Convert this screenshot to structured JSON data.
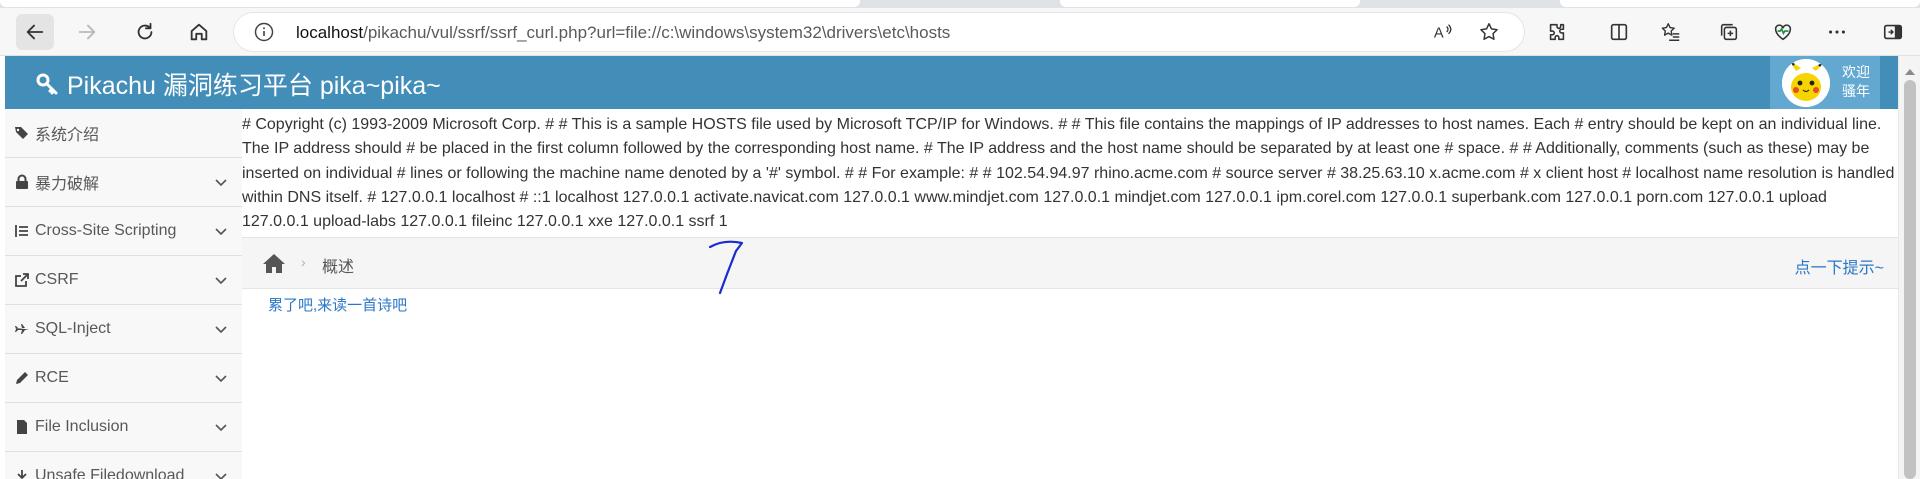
{
  "browser": {
    "url_host": "localhost",
    "url_path": "/pikachu/vul/ssrf/ssrf_curl.php?url=file://c:\\windows\\system32\\drivers\\etc\\hosts",
    "back_icon": "arrow-left-icon",
    "forward_icon": "arrow-right-icon",
    "refresh_icon": "refresh-icon",
    "home_icon": "home-icon",
    "read_aloud_icon": "read-aloud-icon",
    "favorite_icon": "star-icon",
    "extensions_icon": "puzzle-icon",
    "split_screen_icon": "split-screen-icon",
    "favorites_icon": "favorites-list-icon",
    "collections_icon": "collections-icon",
    "performance_icon": "heart-pulse-icon",
    "more_icon": "more-dots-icon",
    "sidebar_icon": "sidebar-toggle-icon"
  },
  "header": {
    "brand_icon": "key-icon",
    "title": "Pikachu 漏洞练习平台 pika~pika~",
    "welcome_line1": "欢迎",
    "welcome_line2": "骚年"
  },
  "sidebar": {
    "items": [
      {
        "label": "系统介绍",
        "icon": "tags-icon",
        "expandable": false
      },
      {
        "label": "暴力破解",
        "icon": "lock-icon",
        "expandable": true
      },
      {
        "label": "Cross-Site Scripting",
        "icon": "indent-icon",
        "expandable": true
      },
      {
        "label": "CSRF",
        "icon": "share-square-icon",
        "expandable": true
      },
      {
        "label": "SQL-Inject",
        "icon": "fighter-jet-icon",
        "expandable": true
      },
      {
        "label": "RCE",
        "icon": "pencil-icon",
        "expandable": true
      },
      {
        "label": "File Inclusion",
        "icon": "file-icon",
        "expandable": true
      },
      {
        "label": "Unsafe Filedownload",
        "icon": "download-icon",
        "expandable": true
      }
    ]
  },
  "main": {
    "hosts_output": "# Copyright (c) 1993-2009 Microsoft Corp. # # This is a sample HOSTS file used by Microsoft TCP/IP for Windows. # # This file contains the mappings of IP addresses to host names. Each # entry should be kept on an individual line. The IP address should # be placed in the first column followed by the corresponding host name. # The IP address and the host name should be separated by at least one # space. # # Additionally, comments (such as these) may be inserted on individual # lines or following the machine name denoted by a '#' symbol. # # For example: # # 102.54.94.97 rhino.acme.com # source server # 38.25.63.10 x.acme.com # x client host # localhost name resolution is handled within DNS itself. # 127.0.0.1 localhost # ::1 localhost 127.0.0.1 activate.navicat.com 127.0.0.1 www.mindjet.com 127.0.0.1 mindjet.com 127.0.0.1 ipm.corel.com 127.0.0.1 superbank.com 127.0.0.1 porn.com 127.0.0.1 upload 127.0.0.1 upload-labs 127.0.0.1 fileinc 127.0.0.1 xxe 127.0.0.1 ssrf 1",
    "breadcrumb": {
      "home_icon": "home-icon",
      "current": "概述",
      "hint_link": "点一下提示~"
    },
    "poem_link": "累了吧,来读一首诗吧",
    "annotation": "hand-drawn-arrow"
  },
  "colors": {
    "header_bg": "#438eb9",
    "user_area_bg": "#62a8d1",
    "link": "#2a76c7",
    "annotation_ink": "#1a2bd0"
  }
}
